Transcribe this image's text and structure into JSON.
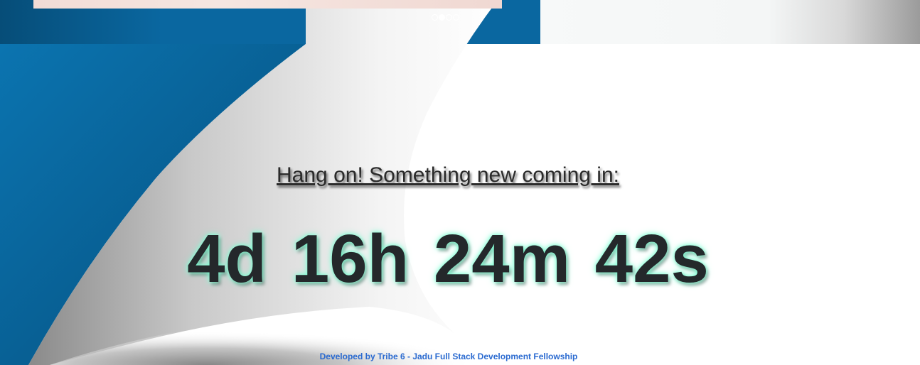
{
  "carousel": {
    "dots": [
      {
        "active": false
      },
      {
        "active": true
      },
      {
        "active": false
      },
      {
        "active": false
      }
    ]
  },
  "main": {
    "heading": "Hang on! Something new coming in:",
    "countdown": "4d 16h 24m 42s"
  },
  "footer": {
    "text": "Developed by Tribe 6 - Jadu Full Stack Development Fellowship"
  },
  "colors": {
    "blue": "#0a6aa1",
    "countdown_glow": "#7fffd4",
    "footer_text": "#2a6ad0"
  }
}
